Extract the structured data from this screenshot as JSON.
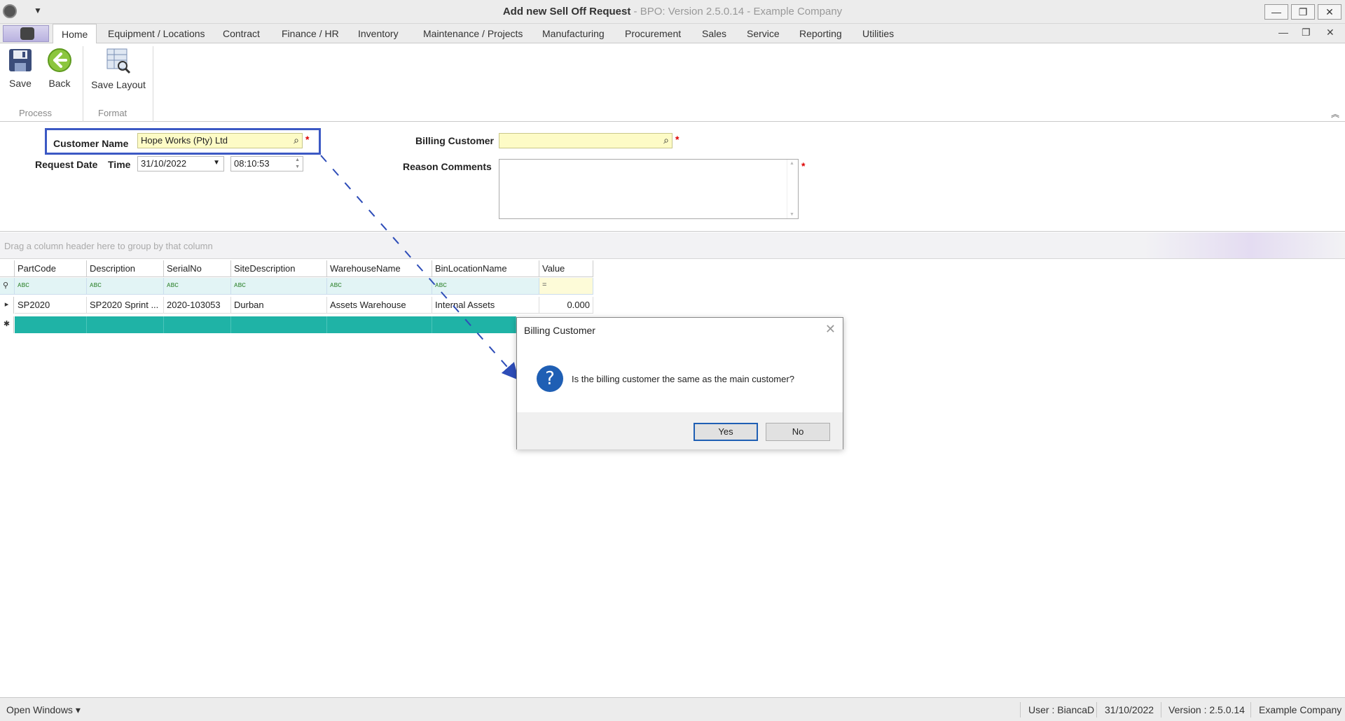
{
  "window": {
    "title_main": "Add new Sell Off Request",
    "title_sub": " - BPO: Version 2.5.0.14 - Example Company",
    "minimize": "—",
    "restore": "❐",
    "close": "✕"
  },
  "tabs": [
    "Home",
    "Equipment / Locations",
    "Contract",
    "Finance / HR",
    "Inventory",
    "Maintenance / Projects",
    "Manufacturing",
    "Procurement",
    "Sales",
    "Service",
    "Reporting",
    "Utilities"
  ],
  "ribbon": {
    "save": "Save",
    "back": "Back",
    "save_layout": "Save Layout",
    "group_process": "Process",
    "group_format": "Format"
  },
  "form": {
    "customer_name_label": "Customer Name",
    "customer_name_value": "Hope Works (Pty) Ltd",
    "request_date_label": "Request Date",
    "time_label": "Time",
    "request_date_value": "31/10/2022",
    "time_value": "08:10:53",
    "billing_customer_label": "Billing Customer",
    "billing_customer_value": "",
    "reason_comments_label": "Reason Comments",
    "required_mark": "*"
  },
  "grid": {
    "group_hint": "Drag a column header here to group by that column",
    "columns": [
      "PartCode",
      "Description",
      "SerialNo",
      "SiteDescription",
      "WarehouseName",
      "BinLocationName",
      "Value"
    ],
    "filter_text": "ᴀ͏ʙc",
    "filter_eq": "=",
    "rows": [
      [
        "SP2020",
        "SP2020 Sprint ...",
        "2020-103053",
        "Durban",
        "Assets Warehouse",
        "Internal Assets",
        "0.000"
      ]
    ],
    "row_indicator": "▸",
    "new_row_indicator": "✱"
  },
  "dialog": {
    "title": "Billing Customer",
    "close": "✕",
    "icon": "?",
    "message": "Is the billing customer the same as the main customer?",
    "yes": "Yes",
    "no": "No"
  },
  "status": {
    "open_windows": "Open Windows ▾",
    "user": "User : BiancaD",
    "date": "31/10/2022",
    "version": "Version : 2.5.0.14",
    "company": "Example Company"
  },
  "colors": {
    "accent": "#1f5fb4",
    "highlight": "#3c59c4",
    "new_row": "#1fb3a6",
    "required": "#dd0000"
  }
}
